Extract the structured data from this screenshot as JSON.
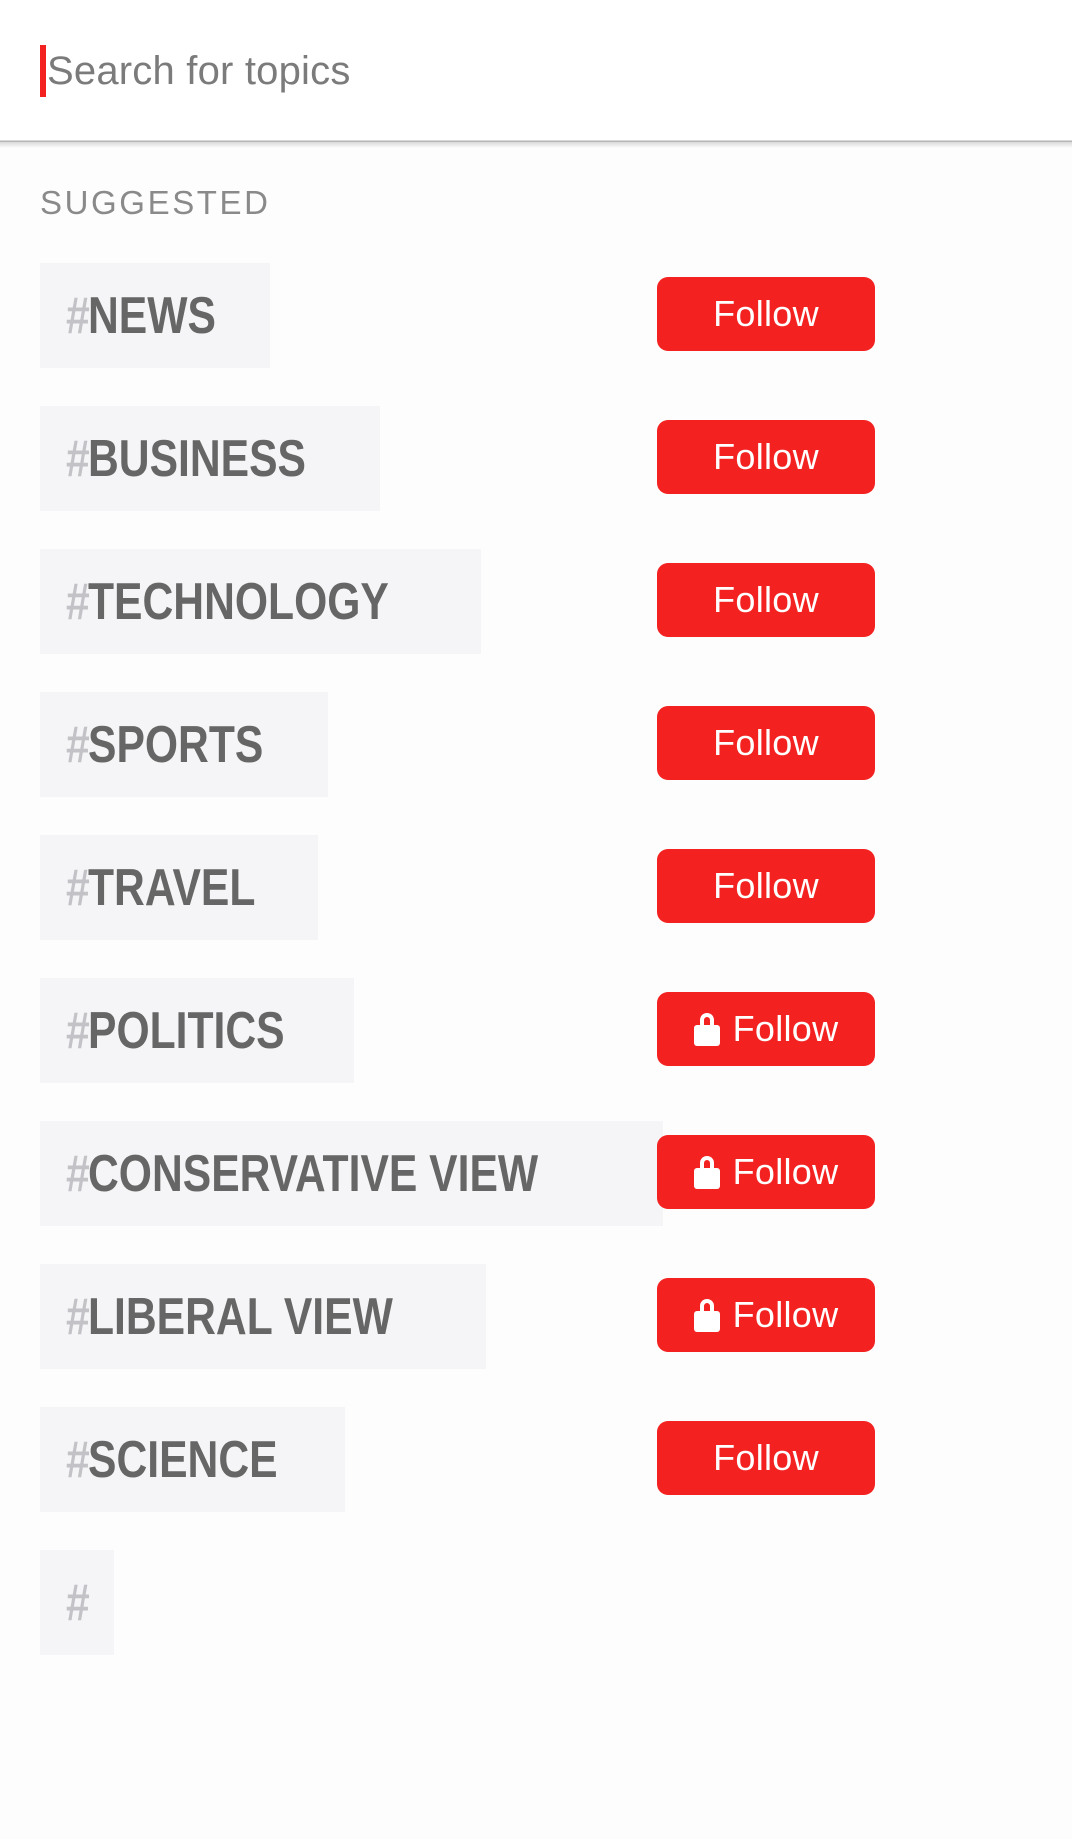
{
  "search": {
    "placeholder": "Search for topics",
    "value": "",
    "caret_color": "#f42121"
  },
  "section": {
    "title": "SUGGESTED"
  },
  "button_defaults": {
    "follow_label": "Follow",
    "accent_color": "#f42121",
    "lock_icon": "lock-icon"
  },
  "chip_style": {
    "background": "#f5f5f7",
    "hash_color": "#c3c3c7",
    "name_color": "#666666"
  },
  "topics": [
    {
      "hash": "#",
      "name": "NEWS",
      "follow_label": "Follow",
      "locked": false
    },
    {
      "hash": "#",
      "name": "BUSINESS",
      "follow_label": "Follow",
      "locked": false
    },
    {
      "hash": "#",
      "name": "TECHNOLOGY",
      "follow_label": "Follow",
      "locked": false
    },
    {
      "hash": "#",
      "name": "SPORTS",
      "follow_label": "Follow",
      "locked": false
    },
    {
      "hash": "#",
      "name": "TRAVEL",
      "follow_label": "Follow",
      "locked": false
    },
    {
      "hash": "#",
      "name": "POLITICS",
      "follow_label": "Follow",
      "locked": true
    },
    {
      "hash": "#",
      "name": "CONSERVATIVE VIEW",
      "follow_label": "Follow",
      "locked": true
    },
    {
      "hash": "#",
      "name": "LIBERAL VIEW",
      "follow_label": "Follow",
      "locked": true
    },
    {
      "hash": "#",
      "name": "SCIENCE",
      "follow_label": "Follow",
      "locked": false
    },
    {
      "hash": "#",
      "name": "",
      "follow_label": "",
      "locked": false
    }
  ]
}
